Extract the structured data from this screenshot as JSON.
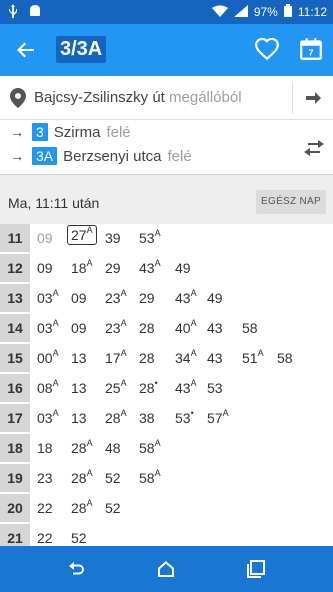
{
  "status": {
    "battery": "97%",
    "time": "11:12"
  },
  "appbar": {
    "title": "3/3A"
  },
  "stop": {
    "name": "Bajcsy-Zsilinszky út",
    "suffix": "megállóból"
  },
  "directions": [
    {
      "route": "3",
      "dest": "Szirma",
      "suffix": "felé"
    },
    {
      "route": "3A",
      "dest": "Berzsenyi utca",
      "suffix": "felé"
    }
  ],
  "day": {
    "label": "Ma, 11:11 után",
    "button": "EGÉSZ NAP"
  },
  "timetable": [
    {
      "hour": "11",
      "minutes": [
        {
          "t": "09",
          "sup": "",
          "past": true
        },
        {
          "t": "27",
          "sup": "A",
          "current": true
        },
        {
          "t": "39",
          "sup": ""
        },
        {
          "t": "53",
          "sup": "A"
        }
      ]
    },
    {
      "hour": "12",
      "minutes": [
        {
          "t": "09",
          "sup": ""
        },
        {
          "t": "18",
          "sup": "A"
        },
        {
          "t": "29",
          "sup": ""
        },
        {
          "t": "43",
          "sup": "A"
        },
        {
          "t": "49",
          "sup": ""
        }
      ]
    },
    {
      "hour": "13",
      "minutes": [
        {
          "t": "03",
          "sup": "A"
        },
        {
          "t": "09",
          "sup": ""
        },
        {
          "t": "23",
          "sup": "A"
        },
        {
          "t": "29",
          "sup": ""
        },
        {
          "t": "43",
          "sup": "A"
        },
        {
          "t": "49",
          "sup": ""
        }
      ]
    },
    {
      "hour": "14",
      "minutes": [
        {
          "t": "03",
          "sup": "A"
        },
        {
          "t": "09",
          "sup": ""
        },
        {
          "t": "23",
          "sup": "A"
        },
        {
          "t": "28",
          "sup": ""
        },
        {
          "t": "40",
          "sup": "A"
        },
        {
          "t": "43",
          "sup": ""
        },
        {
          "t": "58",
          "sup": ""
        }
      ]
    },
    {
      "hour": "15",
      "minutes": [
        {
          "t": "00",
          "sup": "A"
        },
        {
          "t": "13",
          "sup": ""
        },
        {
          "t": "17",
          "sup": "A"
        },
        {
          "t": "28",
          "sup": ""
        },
        {
          "t": "34",
          "sup": "A"
        },
        {
          "t": "43",
          "sup": ""
        },
        {
          "t": "51",
          "sup": "A"
        },
        {
          "t": "58",
          "sup": ""
        }
      ]
    },
    {
      "hour": "16",
      "minutes": [
        {
          "t": "08",
          "sup": "A"
        },
        {
          "t": "13",
          "sup": ""
        },
        {
          "t": "25",
          "sup": "A"
        },
        {
          "t": "28",
          "sup": "•"
        },
        {
          "t": "43",
          "sup": "A"
        },
        {
          "t": "53",
          "sup": ""
        }
      ]
    },
    {
      "hour": "17",
      "minutes": [
        {
          "t": "03",
          "sup": "A"
        },
        {
          "t": "13",
          "sup": ""
        },
        {
          "t": "28",
          "sup": "A"
        },
        {
          "t": "38",
          "sup": ""
        },
        {
          "t": "53",
          "sup": "•"
        },
        {
          "t": "57",
          "sup": "A"
        }
      ]
    },
    {
      "hour": "18",
      "minutes": [
        {
          "t": "18",
          "sup": ""
        },
        {
          "t": "28",
          "sup": "A"
        },
        {
          "t": "48",
          "sup": ""
        },
        {
          "t": "58",
          "sup": "A"
        }
      ]
    },
    {
      "hour": "19",
      "minutes": [
        {
          "t": "23",
          "sup": ""
        },
        {
          "t": "28",
          "sup": "A"
        },
        {
          "t": "52",
          "sup": ""
        },
        {
          "t": "58",
          "sup": "A"
        }
      ]
    },
    {
      "hour": "20",
      "minutes": [
        {
          "t": "22",
          "sup": ""
        },
        {
          "t": "28",
          "sup": "A"
        },
        {
          "t": "52",
          "sup": ""
        }
      ]
    },
    {
      "hour": "21",
      "minutes": [
        {
          "t": "22",
          "sup": ""
        },
        {
          "t": "52",
          "sup": ""
        }
      ]
    }
  ],
  "colors": {
    "primary": "#2196f3",
    "primary_dark": "#1565c0",
    "accent_badge": "#2196f3"
  },
  "icons": {
    "back": "arrow-back-icon",
    "favorite": "heart-outline-icon",
    "calendar": "calendar-icon",
    "location": "location-pin-icon",
    "go": "arrow-right-icon",
    "swap": "swap-horiz-icon"
  }
}
